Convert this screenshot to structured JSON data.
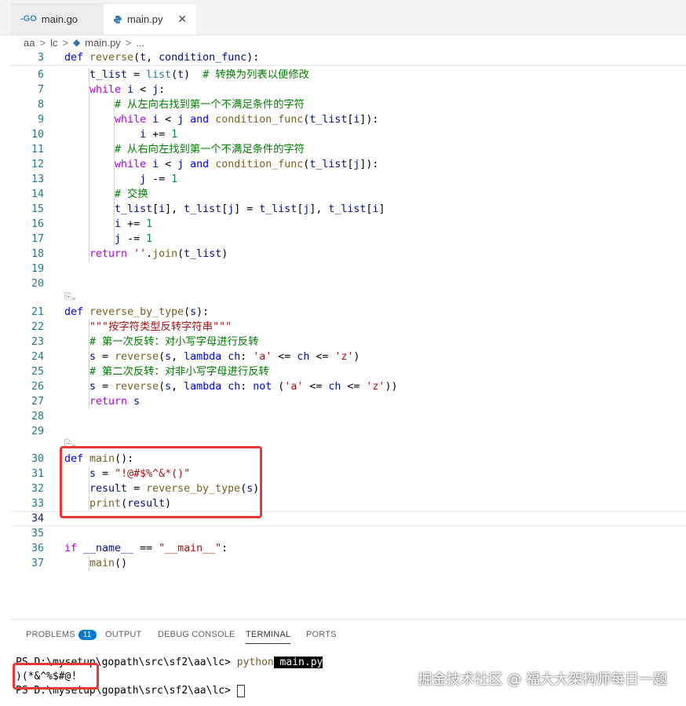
{
  "tabs": [
    {
      "label": "main.go",
      "icon": "go-icon"
    },
    {
      "label": "main.py",
      "icon": "python-icon",
      "close": "✕"
    }
  ],
  "breadcrumb": [
    "aa",
    "lc",
    "main.py",
    "..."
  ],
  "panel": {
    "tabs": [
      "PROBLEMS",
      "OUTPUT",
      "DEBUG CONSOLE",
      "TERMINAL",
      "PORTS"
    ],
    "problems_count": "11",
    "active_tab": "TERMINAL"
  },
  "terminal": {
    "line1_prompt": "PS D:\\mysetup\\gopath\\src\\sf2\\aa\\lc> ",
    "line1_cmd": "python",
    "line1_arg": " main.py",
    "line2": ")(*&^%$#@!",
    "line3_prompt": "PS D:\\mysetup\\gopath\\src\\sf2\\aa\\lc> "
  },
  "watermark": "掘金技术社区 @ 福大大架构师每日一题",
  "colors": {
    "accent": "#007acc",
    "highlight_box": "#e53935"
  }
}
